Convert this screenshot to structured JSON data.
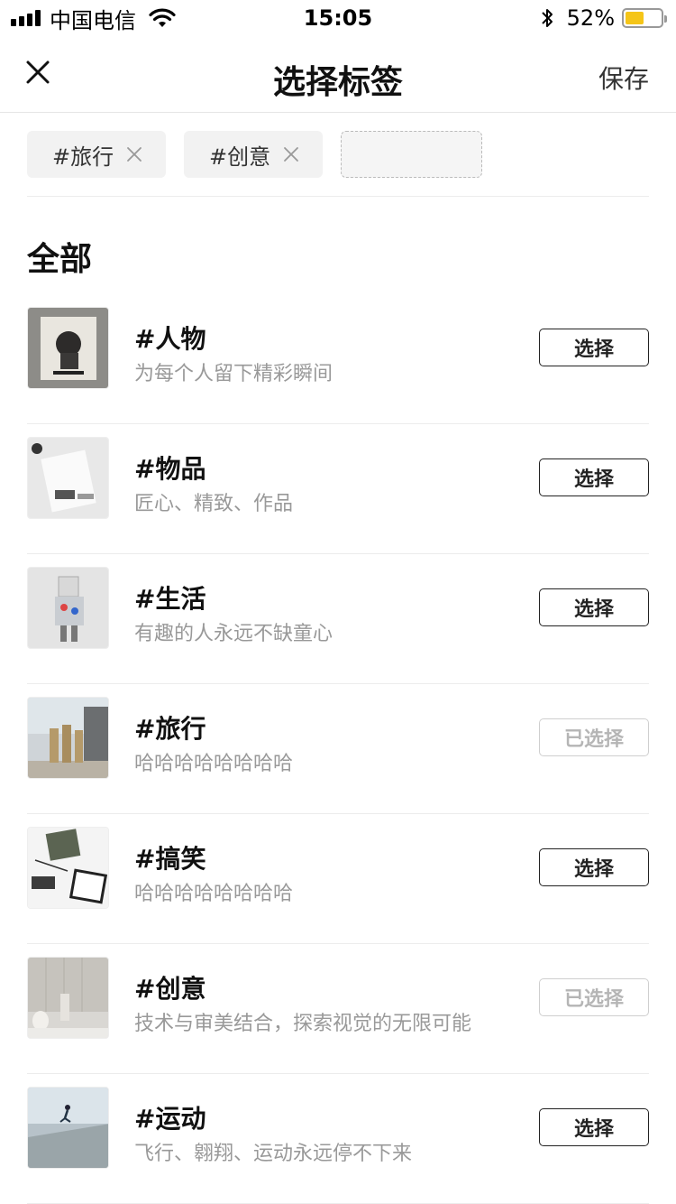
{
  "status_bar": {
    "carrier": "中国电信",
    "time": "15:05",
    "battery": "52%",
    "battery_level": 0.52
  },
  "nav": {
    "close_icon": "close-icon",
    "title": "选择标签",
    "save_label": "保存"
  },
  "selected_tags": [
    {
      "label": "#旅行"
    },
    {
      "label": "#创意"
    }
  ],
  "section_title": "全部",
  "tags": [
    {
      "title": "#人物",
      "desc": "为每个人留下精彩瞬间",
      "button": "选择",
      "selected": false
    },
    {
      "title": "#物品",
      "desc": "匠心、精致、作品",
      "button": "选择",
      "selected": false
    },
    {
      "title": "#生活",
      "desc": "有趣的人永远不缺童心",
      "button": "选择",
      "selected": false
    },
    {
      "title": "#旅行",
      "desc": "哈哈哈哈哈哈哈哈",
      "button": "已选择",
      "selected": true
    },
    {
      "title": "#搞笑",
      "desc": "哈哈哈哈哈哈哈哈",
      "button": "选择",
      "selected": false
    },
    {
      "title": "#创意",
      "desc": "技术与审美结合，探索视觉的无限可能",
      "button": "已选择",
      "selected": true
    },
    {
      "title": "#运动",
      "desc": "飞行、翱翔、运动永远停不下来",
      "button": "选择",
      "selected": false
    }
  ]
}
